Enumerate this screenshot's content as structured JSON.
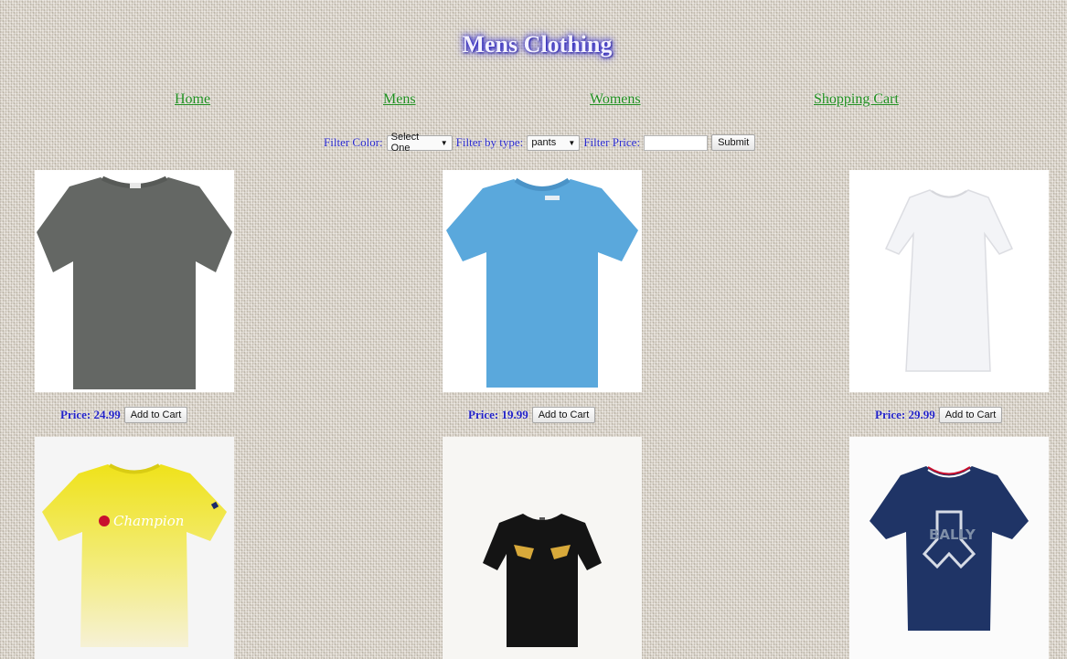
{
  "title": "Mens Clothing",
  "nav": {
    "home": "Home",
    "mens": "Mens",
    "womens": "Womens",
    "cart": "Shopping Cart"
  },
  "filters": {
    "color_label": "Filter Color:",
    "color_selected": "Select One",
    "type_label": "Filter by type:",
    "type_selected": "pants",
    "price_label": "Filter Price:",
    "price_value": "",
    "submit_label": "Submit"
  },
  "products": [
    {
      "price_text": "Price: 24.99",
      "button_label": "Add to Cart",
      "image": "gray-tshirt"
    },
    {
      "price_text": "Price: 19.99",
      "button_label": "Add to Cart",
      "image": "blue-tshirt"
    },
    {
      "price_text": "Price: 29.99",
      "button_label": "Add to Cart",
      "image": "white-tshirt"
    },
    {
      "price_text": "",
      "button_label": "",
      "image": "yellow-champion-tshirt",
      "logo_text": "Champion"
    },
    {
      "price_text": "",
      "button_label": "",
      "image": "black-eyes-tshirt"
    },
    {
      "price_text": "",
      "button_label": "",
      "image": "navy-bally-tshirt",
      "logo_text": "BALLY"
    }
  ],
  "colors": {
    "title_glow": "#2a24c8",
    "nav_link": "#1f8f1f",
    "filter_text": "#2a2ad0",
    "price_text": "#2222c8"
  }
}
